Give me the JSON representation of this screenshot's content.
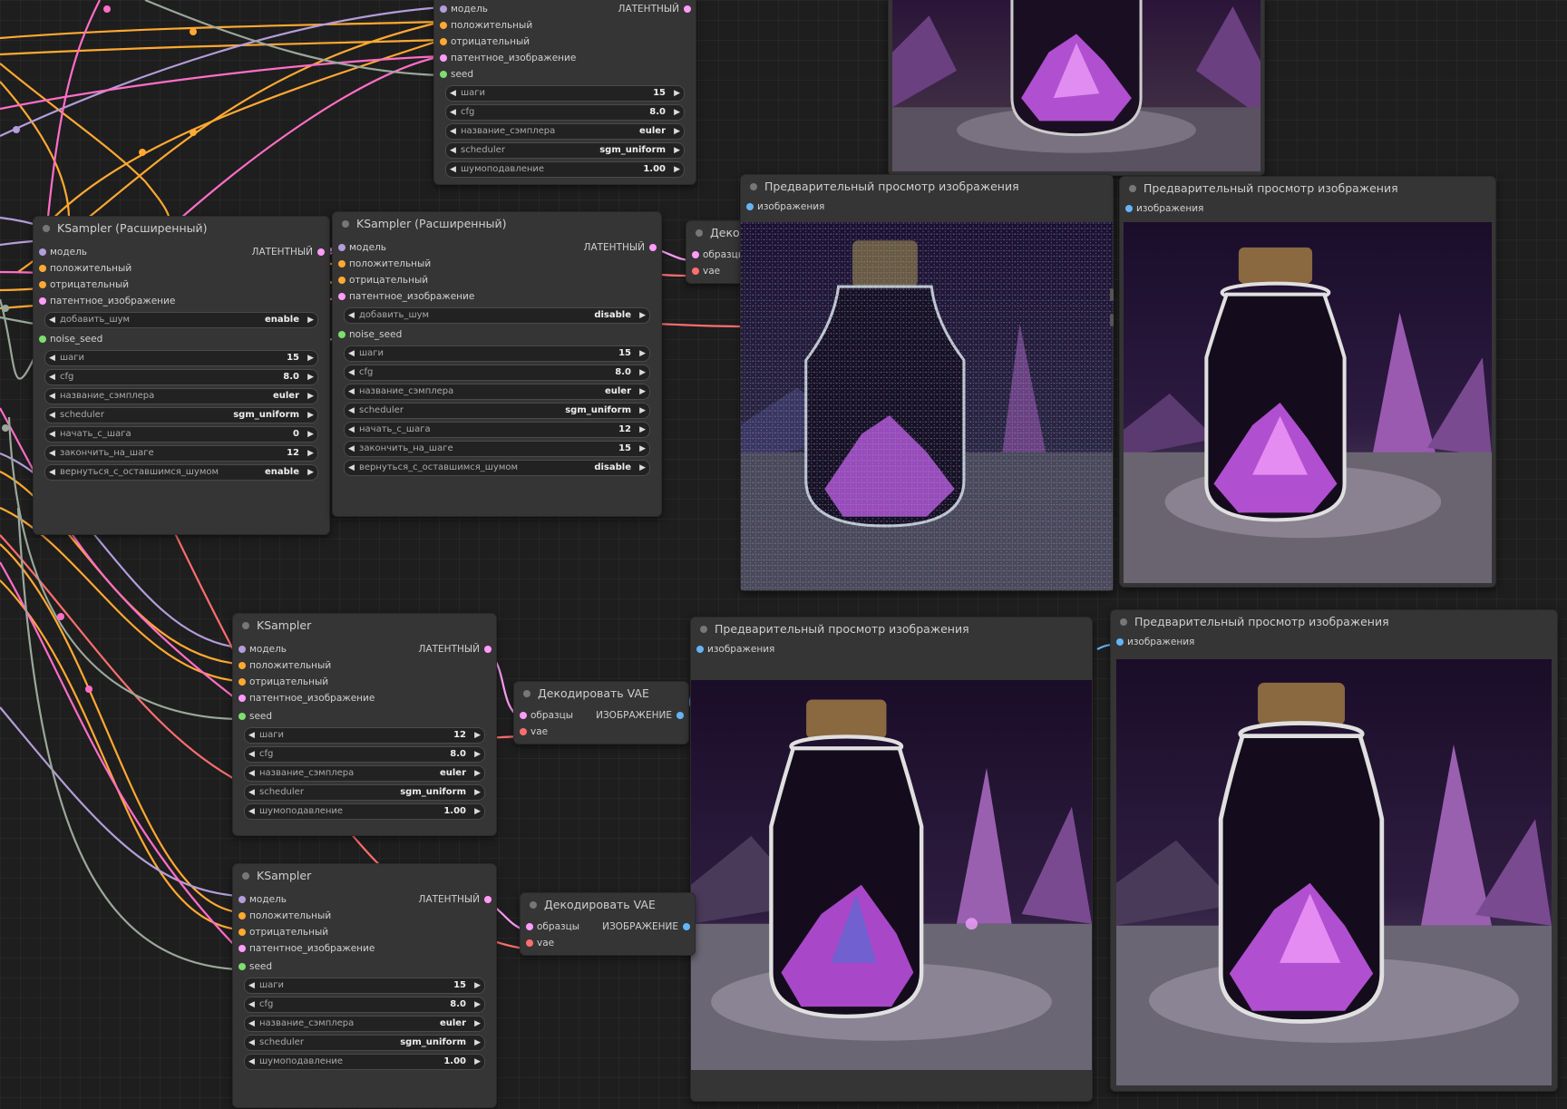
{
  "labels": {
    "model": "модель",
    "positive": "положительный",
    "negative": "отрицательный",
    "latent_image": "патентное_изображение",
    "latent_out": "ЛАТЕНТНЫЙ",
    "seed": "seed",
    "noise_seed": "noise_seed",
    "samples": "образцы",
    "vae": "vae",
    "image_out": "ИЗОБРАЖЕНИЕ",
    "images": "изображения",
    "steps": "шаги",
    "cfg": "cfg",
    "sampler_name": "название_сэмплера",
    "scheduler": "scheduler",
    "denoise": "шумоподавление",
    "add_noise": "добавить_шум",
    "start_at_step": "начать_с_шага",
    "end_at_step": "закончить_на_шаге",
    "return_with_leftover_noise": "вернуться_с_оставшимся_шумом",
    "left_arrow": "◀",
    "right_arrow": "▶"
  },
  "colors": {
    "model": "#b39ddb",
    "conditioning": "#ffa931",
    "latent": "#ff9cf9",
    "seed": "#7ddf6d",
    "image": "#64b5f6",
    "vae": "#ff6e6e",
    "wire_gray": "#9aa89a"
  },
  "icons": {
    "node_dot": "circle-dot-icon",
    "widget_arrows": [
      "arrow-left-icon",
      "arrow-right-icon"
    ]
  },
  "nodes": {
    "ks_top": {
      "title": "",
      "steps": "15",
      "cfg": "8.0",
      "sampler_name": "euler",
      "scheduler": "sgm_uniform",
      "denoise": "1.00"
    },
    "ksa1": {
      "title": "KSampler (Расширенный)",
      "add_noise": "enable",
      "steps": "15",
      "cfg": "8.0",
      "sampler_name": "euler",
      "scheduler": "sgm_uniform",
      "start_at_step": "0",
      "end_at_step": "12",
      "return_with_leftover_noise": "enable"
    },
    "ksa2": {
      "title": "KSampler (Расширенный)",
      "add_noise": "disable",
      "steps": "15",
      "cfg": "8.0",
      "sampler_name": "euler",
      "scheduler": "sgm_uniform",
      "start_at_step": "12",
      "end_at_step": "15",
      "return_with_leftover_noise": "disable"
    },
    "vae1": {
      "title": "Декодировать VAE"
    },
    "vae2": {
      "title": "Декодировать VAE"
    },
    "vae3": {
      "title": "Декодировать VAE"
    },
    "prev1": {
      "title": "Предварительный просмотр изображения"
    },
    "prev2": {
      "title": "Предварительный просмотр изображения"
    },
    "prev3": {
      "title": "Предварительный просмотр изображения"
    },
    "prev4": {
      "title": "Предварительный просмотр изображения"
    },
    "ks1": {
      "title": "KSampler",
      "steps": "12",
      "cfg": "8.0",
      "sampler_name": "euler",
      "scheduler": "sgm_uniform",
      "denoise": "1.00"
    },
    "ks2": {
      "title": "KSampler",
      "steps": "15",
      "cfg": "8.0",
      "sampler_name": "euler",
      "scheduler": "sgm_uniform",
      "denoise": "1.00"
    }
  }
}
